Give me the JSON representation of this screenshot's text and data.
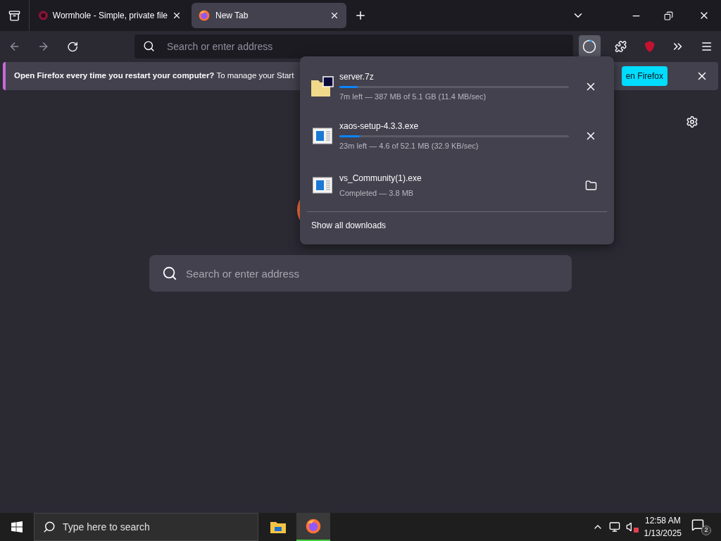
{
  "tabs": [
    {
      "title": "Wormhole - Simple, private file",
      "selected": false
    },
    {
      "title": "New Tab",
      "selected": true
    }
  ],
  "toolbar": {
    "address_placeholder": "Search or enter address",
    "downloads_open": true
  },
  "notification": {
    "message": "**Open Firefox every time you restart your computer?** To manage your Start",
    "button": "en Firefox"
  },
  "downloads": {
    "items": [
      {
        "name": "server.7z",
        "kind": "downloading",
        "level": 0.08,
        "status": "7m left — 387 MB of 5.1 GB (11.4 MB/sec)"
      },
      {
        "name": "xaos-setup-4.3.3.exe",
        "kind": "downloading",
        "level": 0.09,
        "status": "23m left — 4.6 of 52.1 MB (32.9 KB/sec)"
      },
      {
        "name": "vs_Community(1).exe",
        "kind": "completed",
        "status": "Completed — 3.8 MB"
      }
    ],
    "footer": "Show all downloads"
  },
  "new_tab": {
    "search_placeholder": "Search or enter address"
  },
  "taskbar": {
    "search_placeholder": "Type here to search",
    "apps": [
      {
        "selected": false
      },
      {
        "selected": true
      }
    ],
    "time": "12:58 AM",
    "date": "1/13/2025",
    "notification_count": "2",
    "muted": true
  }
}
